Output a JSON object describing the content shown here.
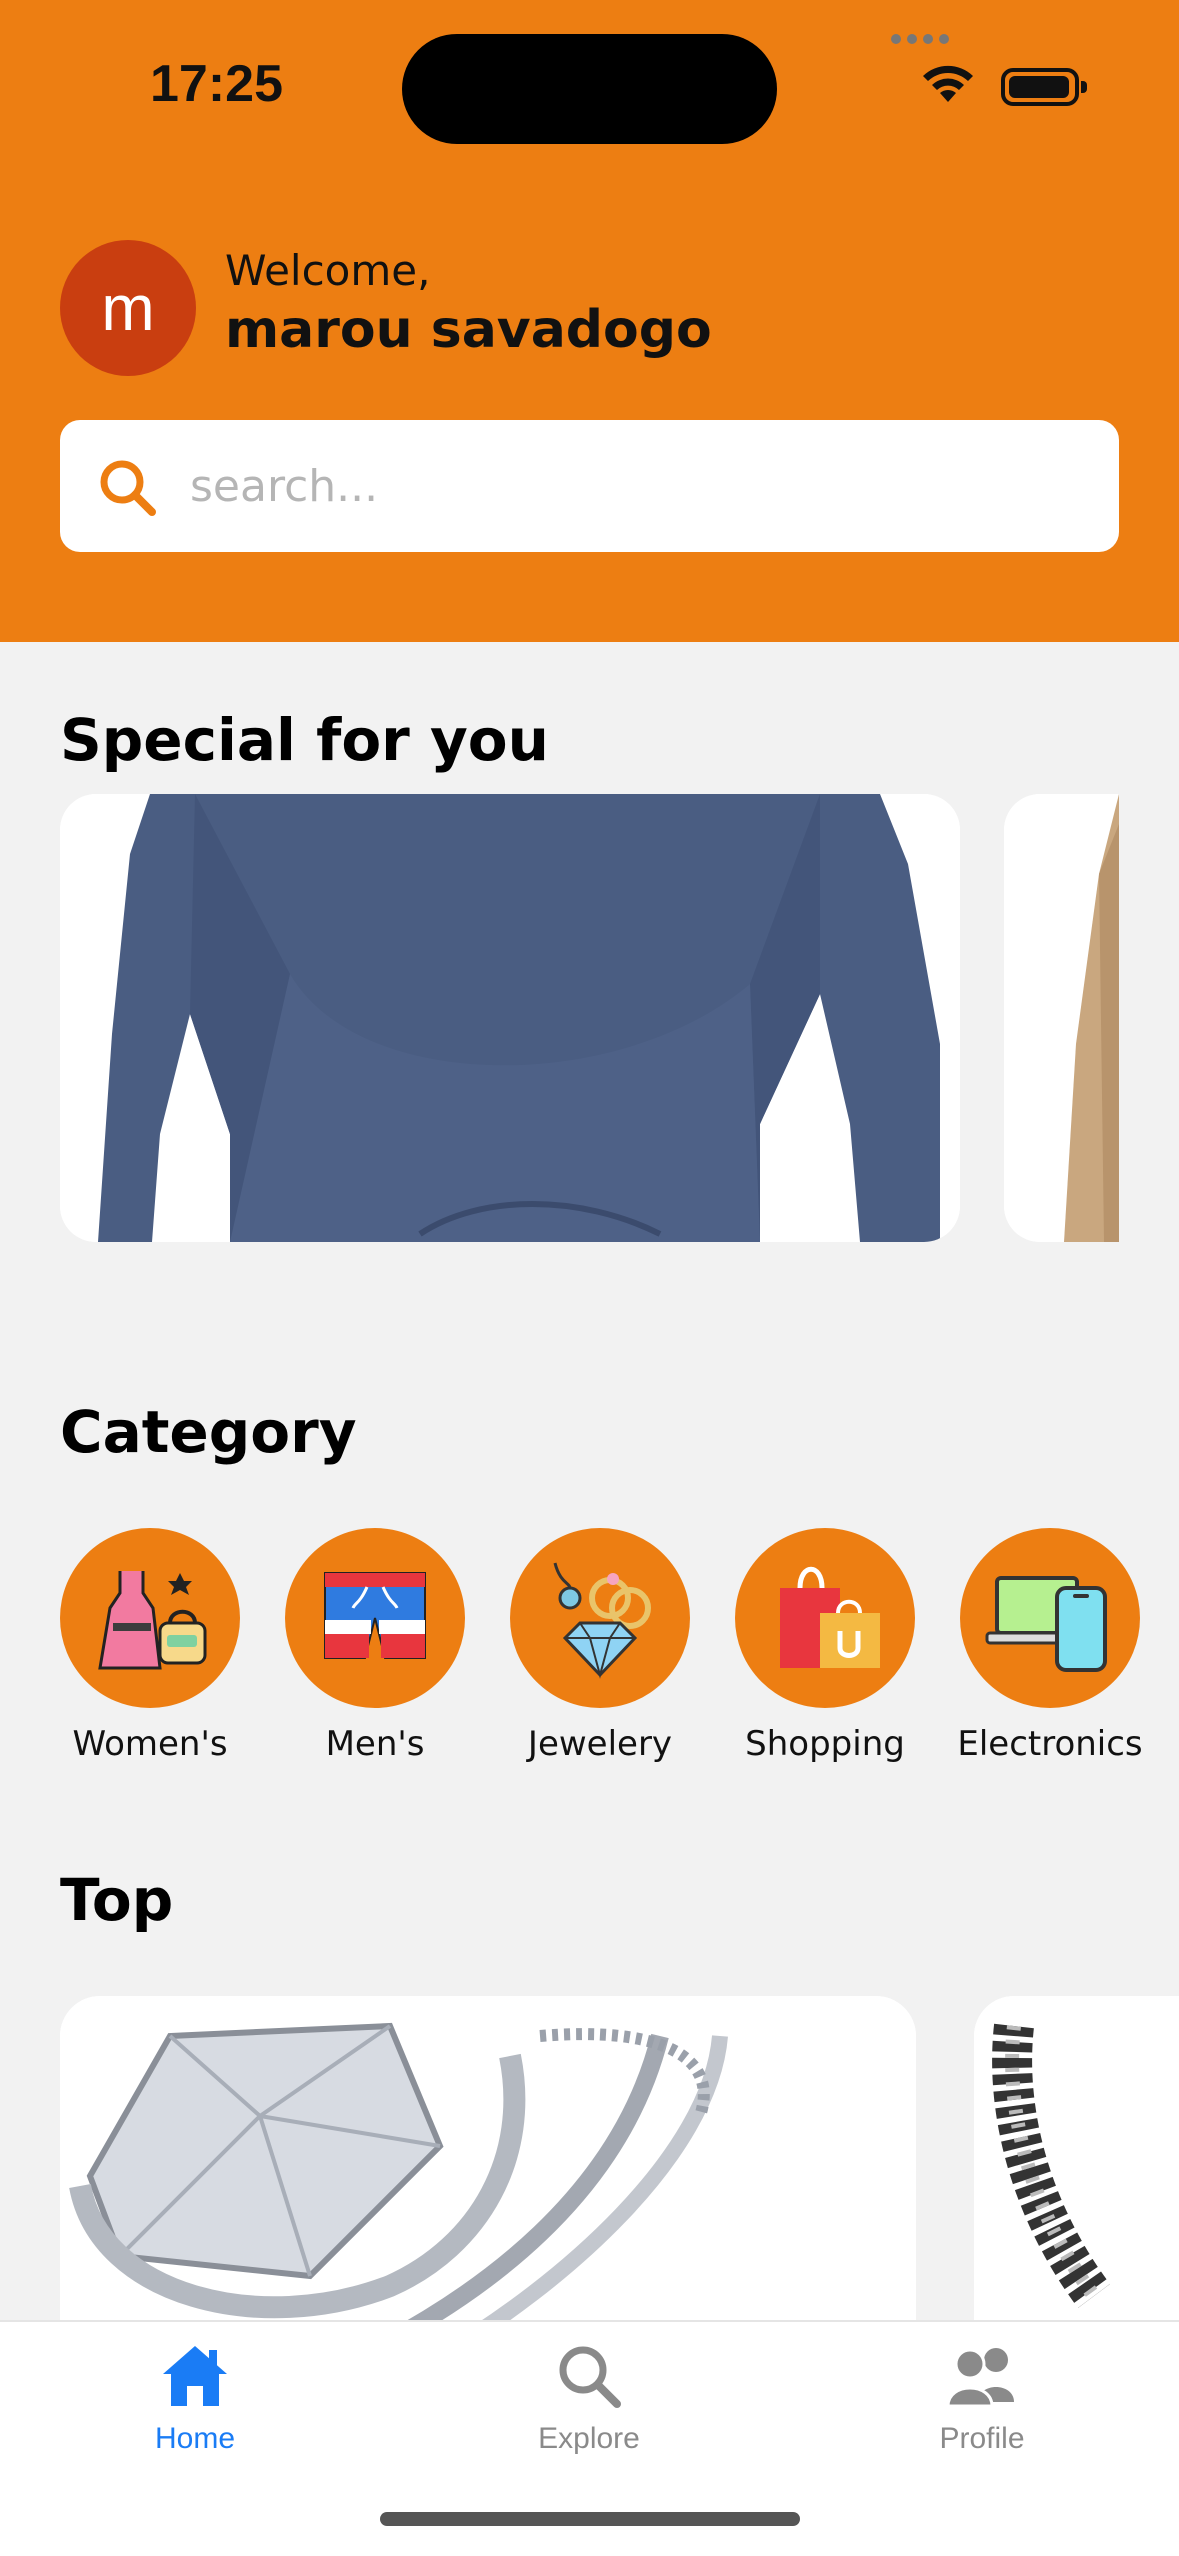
{
  "status_bar": {
    "time": "17:25"
  },
  "user": {
    "avatar_initial": "m",
    "welcome": "Welcome,",
    "name": "marou savadogo"
  },
  "search": {
    "placeholder": "search...",
    "value": ""
  },
  "sections": {
    "special": "Special for you",
    "category": "Category",
    "top": "Top"
  },
  "categories": [
    {
      "label": "Women's",
      "icon": "womens-clothing-icon"
    },
    {
      "label": "Men's",
      "icon": "mens-shorts-icon"
    },
    {
      "label": "Jewelery",
      "icon": "jewelry-icon"
    },
    {
      "label": "Shopping",
      "icon": "shopping-bags-icon"
    },
    {
      "label": "Electronics",
      "icon": "electronics-icon"
    }
  ],
  "tabs": [
    {
      "label": "Home",
      "icon": "home-icon",
      "active": true
    },
    {
      "label": "Explore",
      "icon": "search-icon",
      "active": false
    },
    {
      "label": "Profile",
      "icon": "people-icon",
      "active": false
    }
  ],
  "colors": {
    "accent": "#ed7e12",
    "active_tab": "#1a7cf5",
    "inactive_tab": "#8a8a8a",
    "avatar": "#c93e10"
  }
}
